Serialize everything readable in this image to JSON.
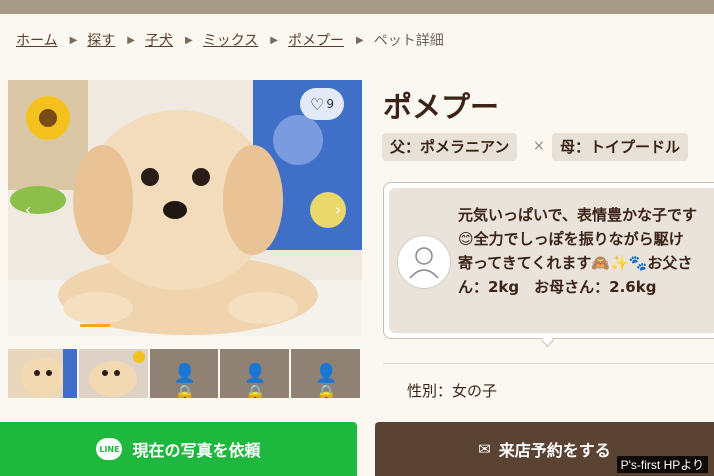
{
  "breadcrumb": {
    "items": [
      "ホーム",
      "探す",
      "子犬",
      "ミックス",
      "ポメプー"
    ],
    "current": "ペット詳細"
  },
  "gallery": {
    "favorite_count": "9",
    "prev_icon": "chevron-left",
    "next_icon": "chevron-right",
    "thumbnails": [
      "photo",
      "photo",
      "locked",
      "locked",
      "locked"
    ]
  },
  "pet": {
    "name": "ポメプー",
    "father": "父：ポメラニアン",
    "times": "×",
    "mother": "母：トイプードル",
    "comment": "元気いっぱいで、表情豊かな子です😊全力でしっぽを振りながら駆け寄ってきてくれます🙈✨🐾お父さん：2kg　お母さん：2.6kg",
    "gender": "性別：女の子"
  },
  "actions": {
    "line_icon_text": "LINE",
    "line_label": "現在の写真を依頼",
    "store_label": "来店予約をする"
  },
  "credit": "P's-first HPより",
  "colors": {
    "line_green": "#1fb83f",
    "store_brown": "#5b4334",
    "accent_orange": "#ff9f2e"
  }
}
